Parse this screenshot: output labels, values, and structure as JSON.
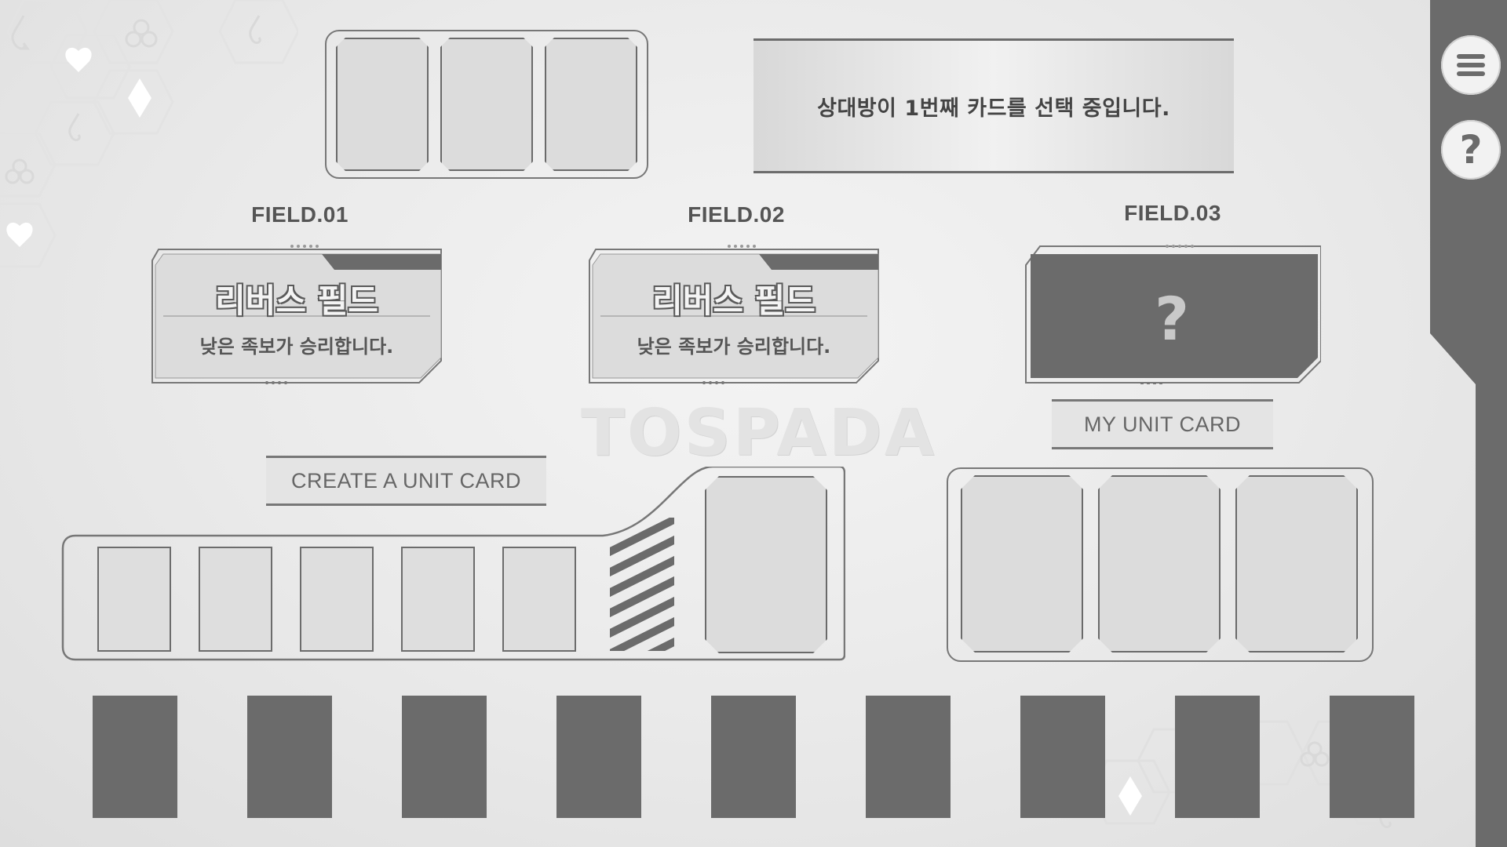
{
  "status": {
    "message": "상대방이 1번째 카드를 선택 중입니다."
  },
  "sidebar": {
    "menu_icon": "menu-icon",
    "help_icon": "help-icon",
    "help_glyph": "?"
  },
  "fields": [
    {
      "label": "FIELD.01",
      "title": "리버스 필드",
      "description": "낮은 족보가 승리합니다.",
      "revealed": true
    },
    {
      "label": "FIELD.02",
      "title": "리버스 필드",
      "description": "낮은 족보가 승리합니다.",
      "revealed": true
    },
    {
      "label": "FIELD.03",
      "hidden_glyph": "?",
      "revealed": false
    }
  ],
  "watermark": "TOSPADA",
  "sections": {
    "create": "CREATE A UNIT CARD",
    "my_unit": "MY UNIT CARD"
  },
  "colors": {
    "dark_gray": "#6b6b6b",
    "light_gray": "#dcdcdc",
    "outline": "#6c6c6c"
  }
}
